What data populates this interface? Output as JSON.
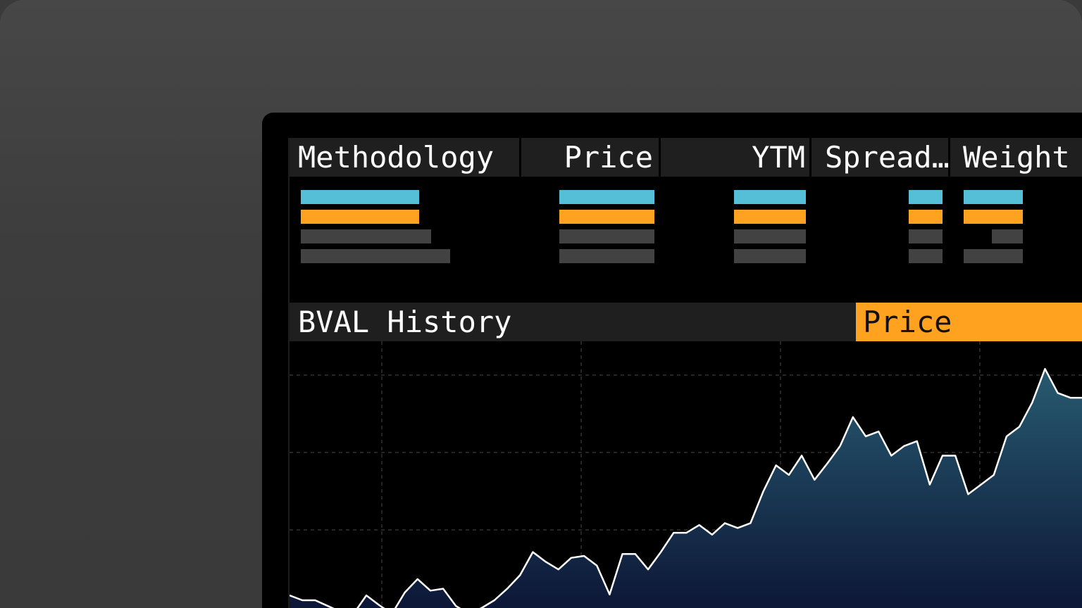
{
  "table": {
    "columns": [
      {
        "key": "methodology",
        "label": "Methodology"
      },
      {
        "key": "price",
        "label": "Price"
      },
      {
        "key": "ytm",
        "label": "YTM"
      },
      {
        "key": "spread",
        "label": "Spread…"
      },
      {
        "key": "weight",
        "label": "Weight"
      }
    ]
  },
  "history": {
    "title": "BVAL History",
    "active_tab": "Price"
  },
  "colors": {
    "accent_orange": "#ffa21f",
    "accent_blue": "#56bfd8",
    "placeholder_gray": "#424242",
    "header_bg": "#1f1f1f",
    "line": "#ffffff",
    "area_top": "#275a70",
    "area_bottom": "#0c1535"
  },
  "chart_data": {
    "type": "area",
    "title": "",
    "xlabel": "",
    "ylabel": "",
    "grid": true,
    "ylim": [
      0,
      100
    ],
    "values": [
      5,
      0,
      0,
      -6,
      -12,
      -14,
      5,
      -5,
      -14,
      8,
      22,
      10,
      12,
      -6,
      -14,
      -8,
      0,
      12,
      26,
      50,
      40,
      32,
      44,
      46,
      36,
      6,
      48,
      48,
      32,
      50,
      70,
      70,
      78,
      68,
      80,
      75,
      80,
      113,
      140,
      130,
      150,
      125,
      142,
      160,
      190,
      170,
      175,
      150,
      160,
      165,
      120,
      150,
      150,
      110,
      120,
      130,
      170,
      180,
      205,
      240,
      215,
      210,
      210
    ]
  }
}
